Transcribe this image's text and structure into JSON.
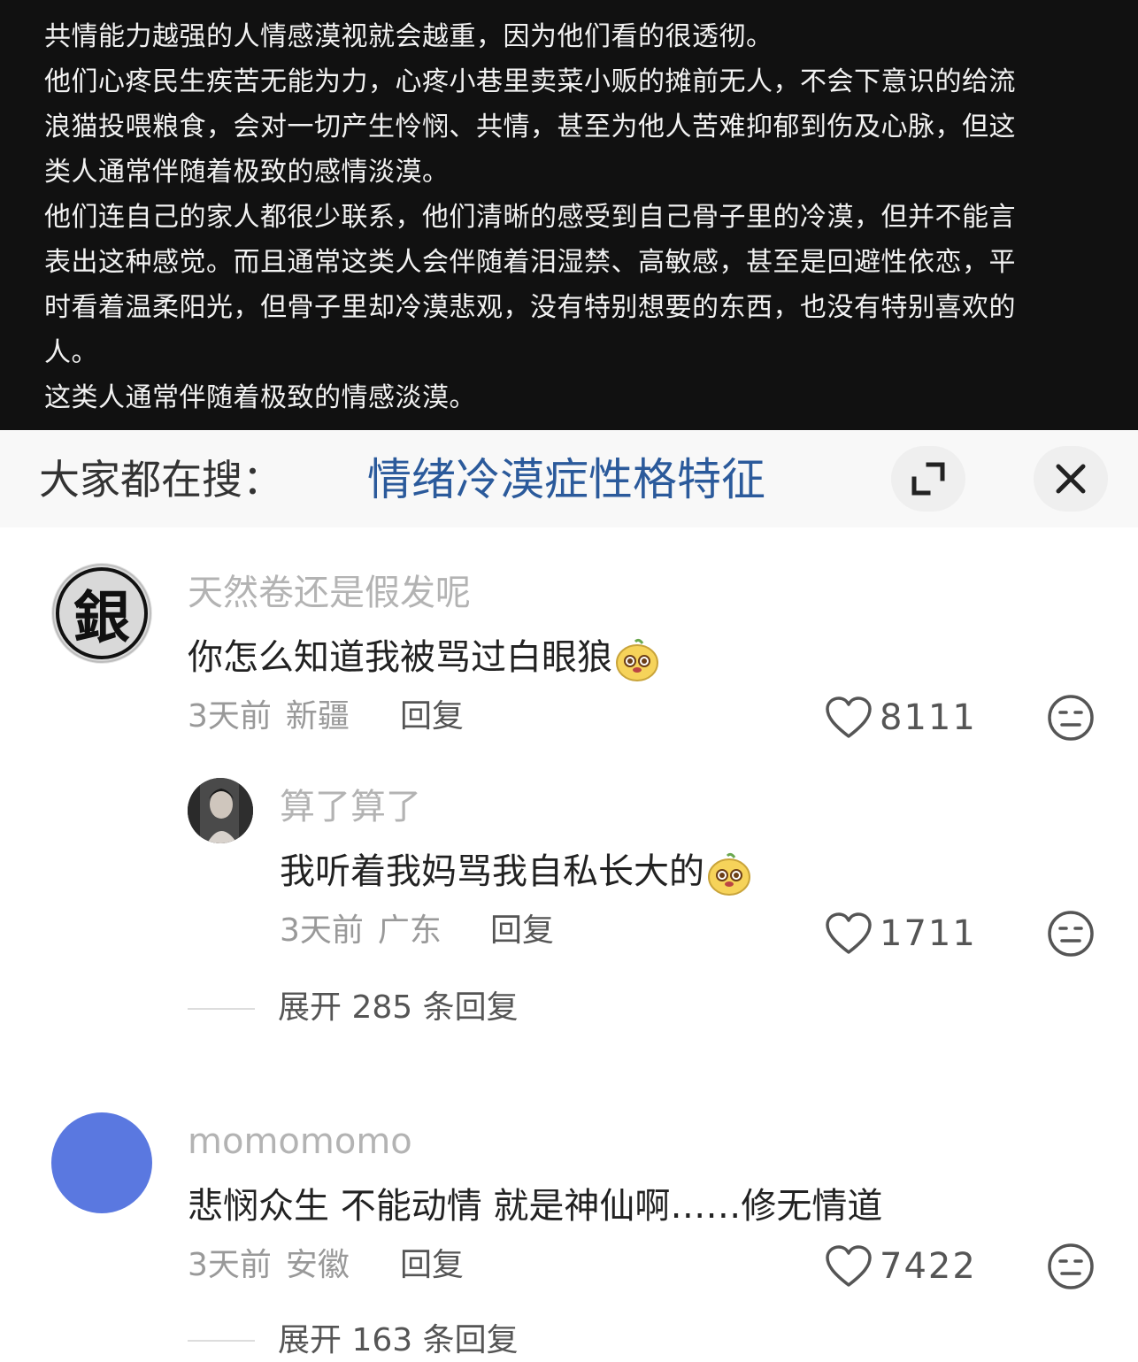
{
  "post": {
    "lines": [
      "共情能力越强的人情感漠视就会越重，因为他们看的很透彻。",
      "他们心疼民生疾苦无能为力，心疼小巷里卖菜小贩的摊前无人，不会下意识的给流",
      "浪猫投喂粮食，会对一切产生怜悯、共情，甚至为他人苦难抑郁到伤及心脉，但这",
      "类人通常伴随着极致的感情淡漠。",
      "他们连自己的家人都很少联系，他们清晰的感受到自己骨子里的冷漠，但并不能言",
      "表出这种感觉。而且通常这类人会伴随着泪湿禁、高敏感，甚至是回避性依恋，平",
      "时看着温柔阳光，但骨子里却冷漠悲观，没有特别想要的东西，也没有特别喜欢的",
      "人。",
      "这类人通常伴随着极致的情感淡漠。"
    ]
  },
  "search": {
    "label": "大家都在搜：",
    "term": "情绪冷漠症性格特征"
  },
  "comments": [
    {
      "username": "天然卷还是假发呢",
      "text": "你怎么知道我被骂过白眼狼",
      "time": "3天前",
      "location": "新疆",
      "reply_label": "回复",
      "likes": "8111",
      "avatar_text": "銀",
      "reply": {
        "username": "算了算了",
        "text": "我听着我妈骂我自私长大的",
        "time": "3天前",
        "location": "广东",
        "reply_label": "回复",
        "likes": "1711"
      },
      "expand_label": "展开 285 条回复"
    },
    {
      "username": "momomomo",
      "text": "悲悯众生 不能动情  就是神仙啊……修无情道",
      "time": "3天前",
      "location": "安徽",
      "reply_label": "回复",
      "likes": "7422",
      "expand_label": "展开 163 条回复"
    }
  ],
  "colors": {
    "post_bg": "#111111",
    "search_term": "#2b5a9b",
    "username": "#b3b3b3",
    "avatar_blue": "#5a78e0"
  },
  "icons": [
    "expand-icon",
    "close-icon",
    "heart-icon",
    "dislike-face-icon",
    "emoji-icon"
  ]
}
